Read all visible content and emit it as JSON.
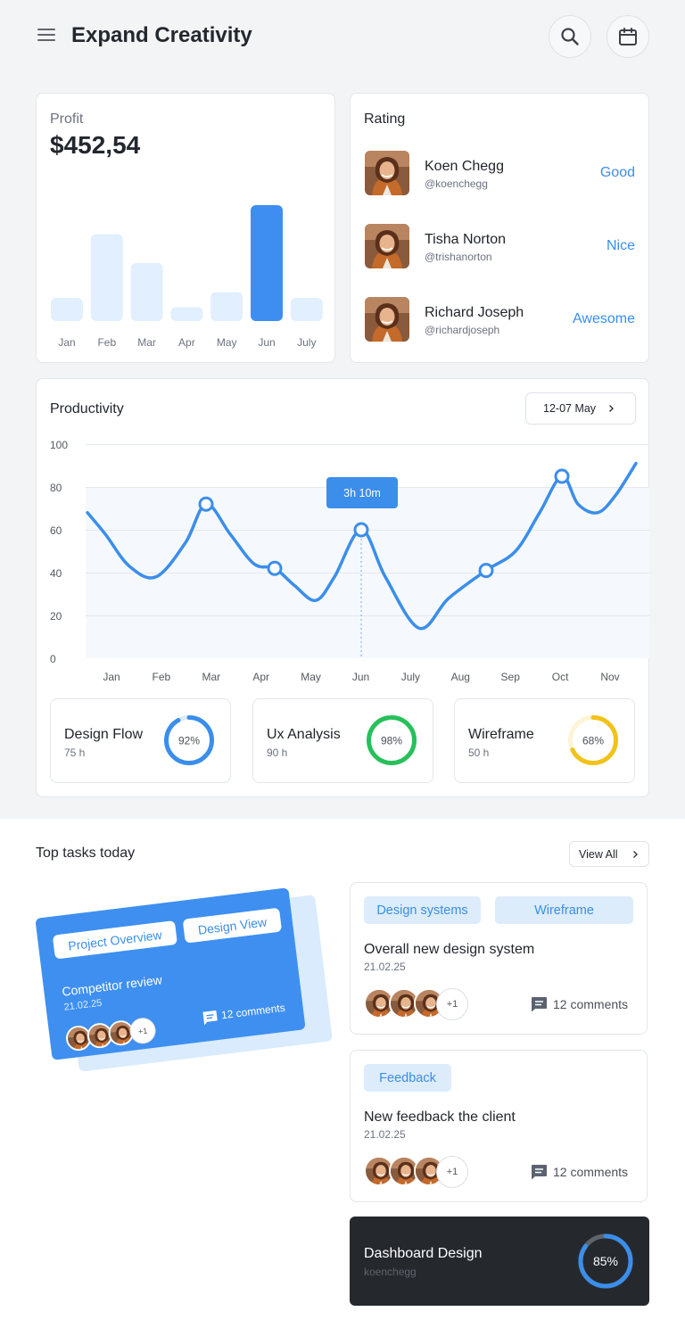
{
  "header": {
    "title": "Expand Creativity"
  },
  "profit": {
    "label": "Profit",
    "amount": "$452,54",
    "chart_data": {
      "type": "bar",
      "categories": [
        "Jan",
        "Feb",
        "Mar",
        "Apr",
        "May",
        "Jun",
        "July"
      ],
      "values": [
        20,
        75,
        50,
        12,
        25,
        100,
        20
      ],
      "highlight": "Jun"
    }
  },
  "rating": {
    "title": "Rating",
    "items": [
      {
        "name": "Koen Chegg",
        "handle": "@koenchegg",
        "rating": "Good"
      },
      {
        "name": "Tisha Norton",
        "handle": "@trishanorton",
        "rating": "Nice"
      },
      {
        "name": "Richard Joseph",
        "handle": "@richardjoseph",
        "rating": "Awesome"
      }
    ]
  },
  "productivity": {
    "title": "Productivity",
    "date_range": "12-07 May",
    "tooltip": "3h 10m",
    "chart_data": {
      "type": "line",
      "x": [
        "Jan",
        "Feb",
        "Mar",
        "Apr",
        "May",
        "Jun",
        "July",
        "Aug",
        "Sep",
        "Oct",
        "Nov"
      ],
      "y_ticks": [
        100,
        80,
        60,
        40,
        20,
        0
      ],
      "ylim": [
        0,
        100
      ],
      "accent": "#3b8eea"
    },
    "stats": [
      {
        "title": "Design Flow",
        "hours": "75 h",
        "percent": 92,
        "percent_label": "92%",
        "color": "#3b8eea",
        "track": "#dcecfb"
      },
      {
        "title": "Ux Analysis",
        "hours": "90 h",
        "percent": 98,
        "percent_label": "98%",
        "color": "#27c05a",
        "track": "#dff5e6"
      },
      {
        "title": "Wireframe",
        "hours": "50 h",
        "percent": 68,
        "percent_label": "68%",
        "color": "#f2c21b",
        "track": "#fdf4d6"
      }
    ]
  },
  "tasks": {
    "title": "Top tasks today",
    "view_all": "View All",
    "featured": {
      "tags": [
        "Project Overview",
        "Design View"
      ],
      "title": "Competitor review",
      "date": "21.02.25",
      "more": "+1",
      "comments": "12 comments"
    },
    "cards": [
      {
        "tags": [
          "Design systems",
          "Wireframe"
        ],
        "title": "Overall new design system",
        "date": "21.02.25",
        "more": "+1",
        "comments": "12 comments"
      },
      {
        "tags": [
          "Feedback"
        ],
        "title": "New feedback the client",
        "date": "21.02.25",
        "more": "+1",
        "comments": "12 comments"
      }
    ],
    "dark_card": {
      "title": "Dashboard Design",
      "user": "koenchegg",
      "percent": 85,
      "percent_label": "85%"
    }
  }
}
